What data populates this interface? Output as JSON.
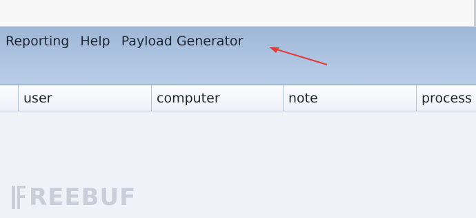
{
  "menu": {
    "items": [
      "Reporting",
      "Help",
      "Payload Generator"
    ]
  },
  "table": {
    "columns": [
      "",
      "user",
      "computer",
      "note",
      "process"
    ]
  },
  "watermark": {
    "text": "REEBUF"
  },
  "colors": {
    "menubar": "#abc2e0",
    "annotation_arrow": "#e53935",
    "watermark": "#c9ced8"
  },
  "icons": [
    "freebuf-logo-icon",
    "annotation-arrow"
  ]
}
